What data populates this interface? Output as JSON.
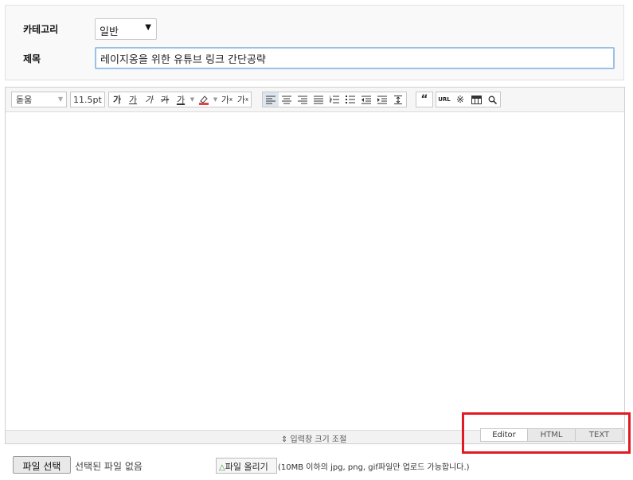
{
  "form": {
    "category_label": "카테고리",
    "category_value": "일반",
    "title_label": "제목",
    "title_value": "레이지옹을 위한 유튜브 링크 간단공략"
  },
  "toolbar": {
    "font_family": "돋움",
    "font_size": "11.5pt",
    "bold": "가",
    "underline": "가",
    "italic": "가",
    "strike": "가",
    "font_color": "가",
    "superscript": "가",
    "subscript": "가",
    "superscript_mark": "x",
    "subscript_mark": "x",
    "url": "URL"
  },
  "editor": {
    "resize_label": "⇕ 입력창 크기 조절",
    "tabs": [
      "Editor",
      "HTML",
      "TEXT"
    ]
  },
  "upload": {
    "choose_file_button": "파일 선택",
    "no_file_text": "선택된 파일 없음",
    "upload_button": "파일 올리기",
    "note": "(10MB 이하의 jpg, png, gif파일만 업로드 가능합니다.)"
  },
  "colors": {
    "highlight": "#e01b24",
    "input_focus": "#9ac1e6"
  }
}
